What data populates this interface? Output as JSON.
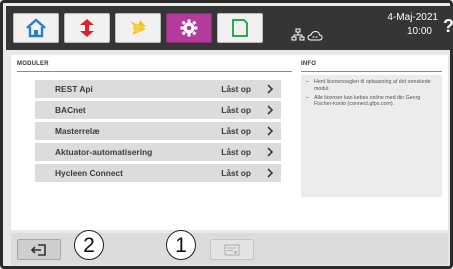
{
  "topbar": {
    "nav": [
      {
        "icon": "home-icon"
      },
      {
        "icon": "swap-arrows-icon"
      },
      {
        "icon": "sun-icon"
      },
      {
        "icon": "gear-icon",
        "active": true
      },
      {
        "icon": "document-icon"
      }
    ],
    "date": "4-Maj-2021",
    "time": "10:00",
    "help": "?",
    "status_icons": [
      "network-icon",
      "cloud-icon"
    ]
  },
  "modules": {
    "title": "MODULER",
    "items": [
      {
        "name": "REST Api",
        "status": "Låst op"
      },
      {
        "name": "BACnet",
        "status": "Låst op"
      },
      {
        "name": "Masterrelæ",
        "status": "Låst op"
      },
      {
        "name": "Aktuator-automatisering",
        "status": "Låst op"
      },
      {
        "name": "Hycleen Connect",
        "status": "Låst op"
      }
    ]
  },
  "info": {
    "title": "INFO",
    "bullets": [
      "Hent licensnoeglen til oplaasning af det oenskede modul.",
      "Alle licenser kan kebes online med din Georg Fischer-konto (connect.gfps.com)."
    ]
  },
  "footer": {
    "back_icon": "exit-icon",
    "license_icon": "license-card-icon"
  },
  "callouts": [
    "2",
    "1"
  ],
  "colors": {
    "active_tab": "#b43b9c",
    "topbar": "#353535"
  }
}
